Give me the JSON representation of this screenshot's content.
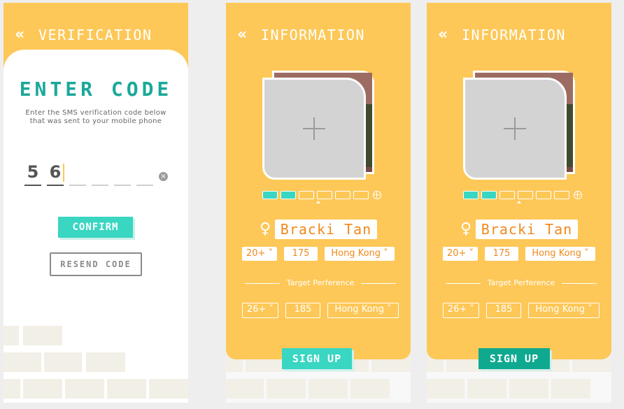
{
  "screens": [
    {
      "title": "VERIFICATION",
      "back_icon": "«",
      "heading": "ENTER CODE",
      "instructions": "Enter the SMS verification code below that was sent to your mobile phone",
      "code_digits": [
        "5",
        "6",
        "",
        "",
        "",
        ""
      ],
      "clear_icon": "×",
      "confirm_label": "CONFIRM",
      "resend_label": "RESEND CODE"
    },
    {
      "title": "INFORMATION",
      "back_icon": "«",
      "gender_icon": "♀",
      "name": "Bracki Tan",
      "profile": {
        "age": "20+ ˅",
        "height": "175",
        "location": "Hong Kong ˅"
      },
      "target_label": "Target Perference",
      "target": {
        "age": "26+ ˅",
        "height": "185",
        "location": "Hong Kong ˅"
      },
      "photo_progress": {
        "filled": 2,
        "total": 6
      },
      "signup_label": "SIGN UP"
    },
    {
      "title": "INFORMATION",
      "back_icon": "«",
      "gender_icon": "♀",
      "name": "Bracki Tan",
      "profile": {
        "age": "20+ ˅",
        "height": "175",
        "location": "Hong Kong ˅"
      },
      "target_label": "Target Perference",
      "target": {
        "age": "26+ ˅",
        "height": "185",
        "location": "Hong Kong ˅"
      },
      "photo_progress": {
        "filled": 2,
        "total": 6
      },
      "signup_label": "SIGN UP"
    }
  ],
  "colors": {
    "brand_yellow": "#fdc858",
    "teal": "#39d6c2",
    "teal_dark": "#0fa990",
    "heading_teal": "#1aa89a",
    "name_orange": "#f08a1c"
  },
  "icons": [
    "back-chevron-icon",
    "clear-icon",
    "plus-icon",
    "add-photo-icon",
    "female-icon",
    "dropdown-icon"
  ]
}
